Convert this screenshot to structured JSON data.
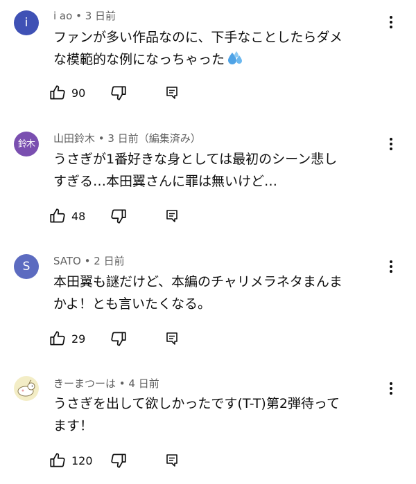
{
  "comments": [
    {
      "avatar_text": "i",
      "avatar_color": "#3f51b5",
      "author": "i ao",
      "time": "3 日前",
      "edited": "",
      "text": "ファンが多い作品なのに、下手なことしたらダメ\nな模範的な例になっちゃった",
      "emoji": "sweat-droplets-icon",
      "likes": "90"
    },
    {
      "avatar_text": "鈴木",
      "avatar_color": "#7a4fb0",
      "author": "山田鈴木",
      "time": "3 日前",
      "edited": "（編集済み）",
      "text": "うさぎが1番好きな身としては最初のシーン悲し\nすぎる…本田翼さんに罪は無いけど…",
      "likes": "48"
    },
    {
      "avatar_text": "S",
      "avatar_color": "#5c6bc0",
      "author": "SATO",
      "time": "2 日前",
      "edited": "",
      "text": "本田翼も謎だけど、本編のチャリメラネタまんま\nかよ！とも言いたくなる。",
      "likes": "29"
    },
    {
      "avatar_text": "",
      "avatar_color": "#f3edc6",
      "author": "きーまつーは",
      "time": "4 日前",
      "edited": "",
      "text": "うさぎを出して欲しかったです(T-T)第2弾待って\nます！",
      "likes": "120"
    }
  ],
  "icons": {
    "like": "thumbs-up-icon",
    "dislike": "thumbs-down-icon",
    "reply": "reply-icon",
    "more": "more-vertical-icon"
  },
  "separator": " • "
}
